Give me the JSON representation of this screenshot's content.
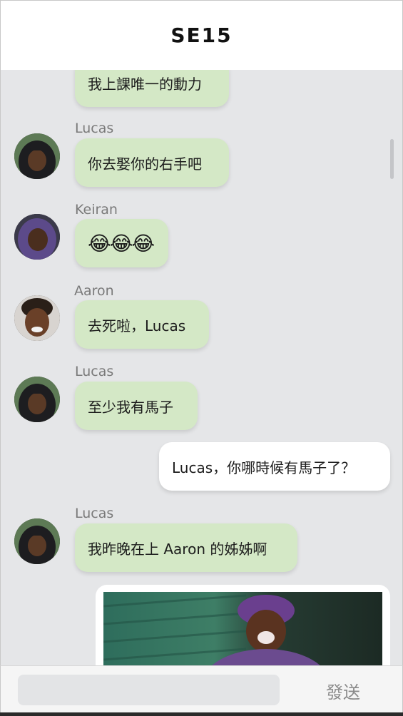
{
  "header": {
    "title": "SE15"
  },
  "messages": [
    {
      "sender": "",
      "text": "我上課唯一的動力",
      "direction": "in"
    },
    {
      "sender": "Lucas",
      "text": "你去娶你的右手吧",
      "direction": "in"
    },
    {
      "sender": "Keiran",
      "text": "😂😂😂",
      "direction": "in"
    },
    {
      "sender": "Aaron",
      "text": "去死啦，Lucas",
      "direction": "in"
    },
    {
      "sender": "Lucas",
      "text": "至少我有馬子",
      "direction": "in"
    },
    {
      "sender": "",
      "text": "Lucas，你哪時候有馬子了？",
      "direction": "out"
    },
    {
      "sender": "Lucas",
      "text": "我昨晚在上 Aaron 的姊姊啊",
      "direction": "in"
    }
  ],
  "input": {
    "placeholder": ""
  },
  "footer": {
    "send_label": "發送"
  },
  "colors": {
    "incoming_bubble": "#d4e8c6",
    "outgoing_bubble": "#ffffff",
    "chat_bg": "#e5e6e8"
  }
}
